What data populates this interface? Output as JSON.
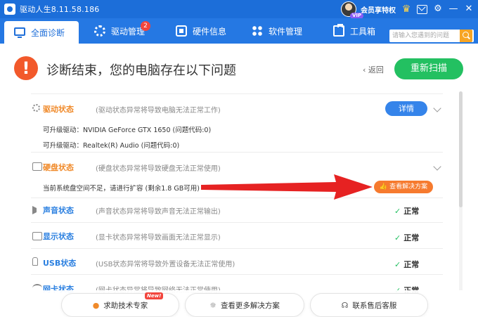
{
  "app": {
    "title": "驱动人生8.11.58.186",
    "member_label": "会员享特权",
    "vip_label": "VIP"
  },
  "nav": {
    "tabs": [
      {
        "label": "全面诊断",
        "icon": "monitor-icon",
        "active": true
      },
      {
        "label": "驱动管理",
        "icon": "gear-icon",
        "badge": "2"
      },
      {
        "label": "硬件信息",
        "icon": "chip-icon"
      },
      {
        "label": "软件管理",
        "icon": "apps-icon"
      },
      {
        "label": "工具箱",
        "icon": "toolbox-icon"
      }
    ],
    "search_placeholder": "请输入您遇到的问题"
  },
  "header": {
    "title": "诊断结束，您的电脑存在以下问题",
    "back_label": "返回",
    "rescan_label": "重新扫描"
  },
  "items": [
    {
      "name": "驱动状态",
      "desc": "(驱动状态异常将导致电脑无法正常工作)",
      "status": "error",
      "color": "#f08a2a",
      "action_label": "详情",
      "sub_lines": [
        "可升级驱动：NVIDIA GeForce GTX 1650 (问题代码:0)",
        "可升级驱动：Realtek(R) Audio (问题代码:0)"
      ]
    },
    {
      "name": "硬盘状态",
      "desc": "(硬盘状态异常将导致硬盘无法正常使用)",
      "status": "error",
      "color": "#f08a2a",
      "sub_lines": [
        "当前系统盘空间不足，请进行扩容 (剩余1.8 GB可用)"
      ],
      "solution_label": "查看解决方案"
    },
    {
      "name": "声音状态",
      "desc": "(声音状态异常将导致声音无法正常输出)",
      "status_label": "正常",
      "color": "#2a7fe0"
    },
    {
      "name": "显示状态",
      "desc": "(显卡状态异常将导致画面无法正常显示)",
      "status_label": "正常",
      "color": "#2a7fe0"
    },
    {
      "name": "USB状态",
      "desc": "(USB状态异常将导致外置设备无法正常使用)",
      "status_label": "正常",
      "color": "#2a7fe0"
    },
    {
      "name": "网卡状态",
      "desc": "(网卡状态异常将导致网络无法正常使用)",
      "status_label": "正常",
      "color": "#2a7fe0"
    }
  ],
  "bottom": {
    "expert_label": "求助技术专家",
    "new_badge": "New!",
    "more_label": "查看更多解决方案",
    "service_label": "联系售后客服"
  },
  "colors": {
    "brand_blue": "#2578e3",
    "accent_orange": "#f08a2a",
    "ok_green": "#23c061",
    "warn_red": "#f2592b"
  }
}
